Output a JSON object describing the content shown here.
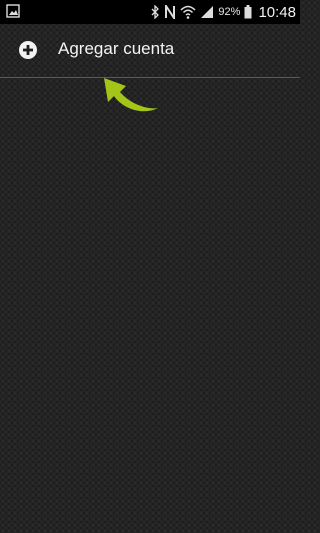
{
  "status_bar": {
    "left_icons": [
      "image-notification-icon"
    ],
    "right_icons": [
      "bluetooth-icon",
      "nfc-icon",
      "wifi-icon",
      "signal-icon",
      "battery-icon"
    ],
    "battery_percent": "92%",
    "time": "10:48"
  },
  "account_list": {
    "add_account_label": "Agregar cuenta",
    "add_icon": "plus-circle-icon"
  },
  "overlay": {
    "arrow_icon": "curved-arrow-icon",
    "arrow_color": "#a3c51a"
  },
  "colors": {
    "background": "#1c1c1c",
    "status_bar": "#000000",
    "text": "#f4f4f4",
    "divider": "#5a5a5a"
  }
}
